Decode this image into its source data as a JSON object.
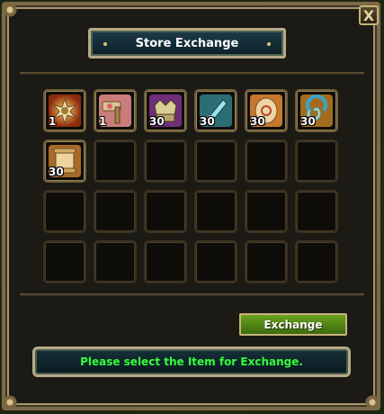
{
  "window": {
    "title": "Store Exchange",
    "close_label": "X"
  },
  "items": [
    {
      "icon": "starburst-medal-icon",
      "quantity": "1"
    },
    {
      "icon": "gem-hammer-icon",
      "quantity": "1"
    },
    {
      "icon": "purple-crown-chest-icon",
      "quantity": "30"
    },
    {
      "icon": "crystal-dagger-icon",
      "quantity": "30"
    },
    {
      "icon": "rune-scroll-icon",
      "quantity": "30"
    },
    {
      "icon": "spiral-orb-icon",
      "quantity": "30"
    },
    {
      "icon": "parchment-scroll-icon",
      "quantity": "30"
    }
  ],
  "actions": {
    "exchange_label": "Exchange"
  },
  "status": {
    "message": "Please select the Item for Exchange."
  },
  "colors": {
    "message_text": "#35ff3a",
    "exchange_button": "#5a9a1a",
    "title_bar": "#133440"
  }
}
